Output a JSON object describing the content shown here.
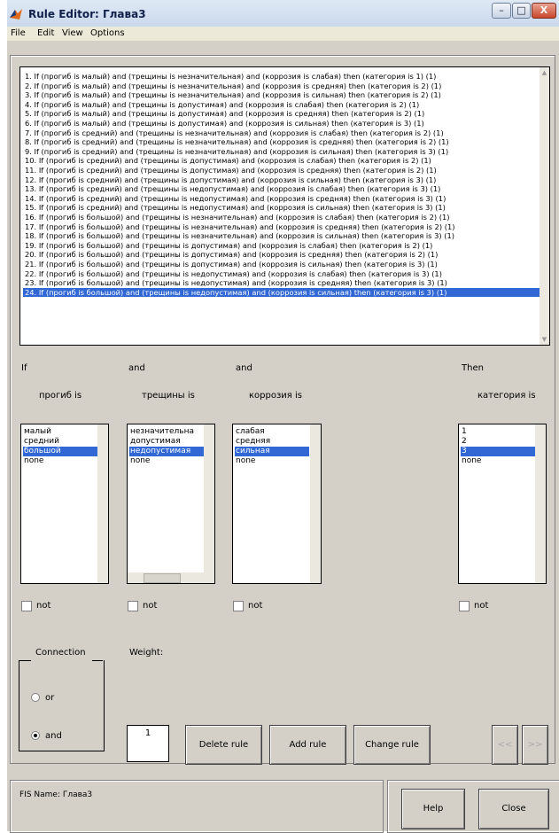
{
  "window": {
    "title": "Rule Editor: Глава3",
    "controls": [
      "–",
      "□",
      "X"
    ]
  },
  "menu": [
    "File",
    "Edit",
    "View",
    "Options"
  ],
  "rules": [
    "1. If (прогиб is малый) and (трещины is незначительная) and (коррозия is слабая) then (категория is 1) (1)",
    "2. If (прогиб is малый) and (трещины is незначительная) and (коррозия is средняя) then (категория is 2) (1)",
    "3. If (прогиб is малый) and (трещины is незначительная) and (коррозия is сильная) then (категория is 2) (1)",
    "4. If (прогиб is малый) and (трещины is допустимая) and (коррозия is слабая) then (категория is 2) (1)",
    "5. If (прогиб is малый) and (трещины is допустимая) and (коррозия is средняя) then (категория is 2) (1)",
    "6. If (прогиб is малый) and (трещины is допустимая) and (коррозия is сильная) then (категория is 3) (1)",
    "7. If (прогиб is средний) and (трещины is незначительная) and (коррозия is слабая) then (категория is 2) (1)",
    "8. If (прогиб is средний) and (трещины is незначительная) and (коррозия is средняя) then (категория is 2) (1)",
    "9. If (прогиб is средний) and (трещины is незначительная) and (коррозия is сильная) then (категория is 3) (1)",
    "10. If (прогиб is средний) and (трещины is допустимая) and (коррозия is слабая) then (категория is 2) (1)",
    "11. If (прогиб is средний) and (трещины is допустимая) and (коррозия is средняя) then (категория is 2) (1)",
    "12. If (прогиб is средний) and (трещины is допустимая) and (коррозия is сильная) then (категория is 3) (1)",
    "13. If (прогиб is средний) and (трещины is недопустимая) and (коррозия is слабая) then (категория is 3) (1)",
    "14. If (прогиб is средний) and (трещины is недопустимая) and (коррозия is средняя) then (категория is 3) (1)",
    "15. If (прогиб is средний) and (трещины is недопустимая) and (коррозия is сильная) then (категория is 3) (1)",
    "16. If (прогиб is большой) and (трещины is незначительная) and (коррозия is слабая) then (категория is 2) (1)",
    "17. If (прогиб is большой) and (трещины is незначительная) and (коррозия is средняя) then (категория is 2) (1)",
    "18. If (прогиб is большой) and (трещины is незначительная) and (коррозия is сильная) then (категория is 3) (1)",
    "19. If (прогиб is большой) and (трещины is допустимая) and (коррозия is слабая) then (категория is 2) (1)",
    "20. If (прогиб is большой) and (трещины is допустимая) and (коррозия is средняя) then (категория is 2) (1)",
    "21. If (прогиб is большой) and (трещины is допустимая) and (коррозия is сильная) then (категория is 3) (1)",
    "22. If (прогиб is большой) and (трещины is недопустимая) and (коррозия is слабая) then (категория is 3) (1)",
    "23. If (прогиб is большой) and (трещины is недопустимая) and (коррозия is средняя) then (категория is 3) (1)",
    "24. If (прогиб is большой) and (трещины is недопустимая) and (коррозия is сильная) then (категория is 3) (1)"
  ],
  "selected_rule": 24,
  "connectors": {
    "if": "If",
    "and1": "and",
    "and2": "and",
    "then": "Then"
  },
  "inputs": [
    {
      "label": "прогиб is",
      "options": [
        "малый",
        "средний",
        "большой",
        "none"
      ],
      "selected": 2,
      "not_label": "not"
    },
    {
      "label": "трещины is",
      "options": [
        "незначительна",
        "допустимая",
        "недопустимая",
        "none"
      ],
      "selected": 2,
      "not_label": "not"
    },
    {
      "label": "коррозия is",
      "options": [
        "слабая",
        "средняя",
        "сильная",
        "none"
      ],
      "selected": 2,
      "not_label": "not"
    }
  ],
  "output": {
    "label": "категория is",
    "options": [
      "1",
      "2",
      "3",
      "none"
    ],
    "selected": 2,
    "not_label": "not"
  },
  "connection": {
    "title": "Connection",
    "options": [
      "or",
      "and"
    ],
    "selected": "and"
  },
  "weight": {
    "label": "Weight:",
    "value": "1"
  },
  "buttons": {
    "delete": "Delete rule",
    "add": "Add rule",
    "change": "Change rule",
    "prev": "<<",
    "next": ">>",
    "help": "Help",
    "close": "Close"
  },
  "status": {
    "fis_name": "FIS Name: Глава3"
  },
  "colors": {
    "selection": "#3168d5",
    "panel": "#d4d0c8"
  }
}
